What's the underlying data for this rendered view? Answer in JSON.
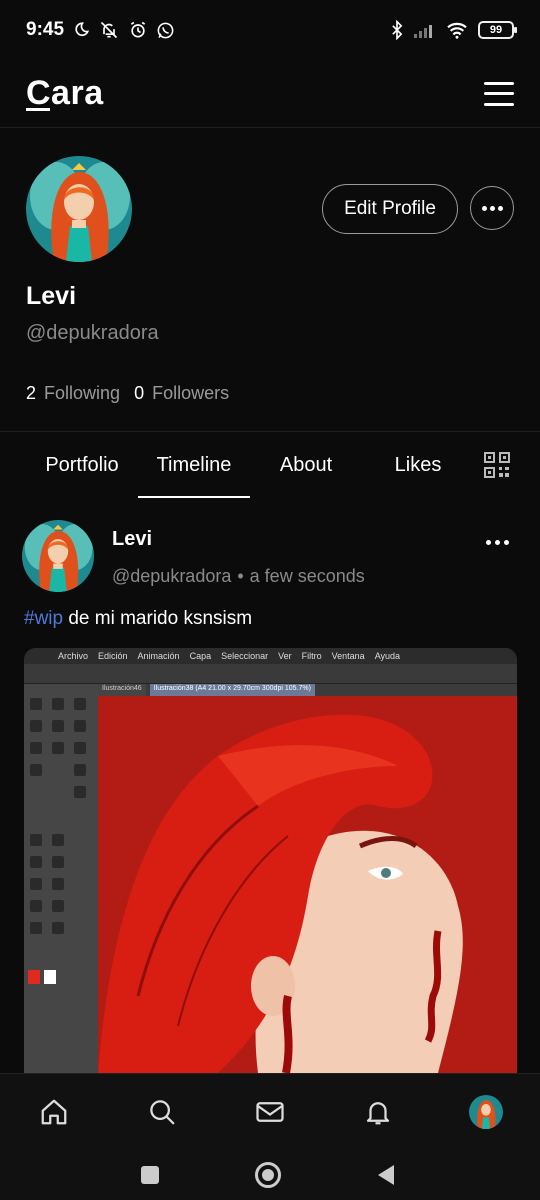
{
  "status_bar": {
    "time": "9:45",
    "battery": "99",
    "left_icons": [
      "moon-icon",
      "muted-bell-icon",
      "alarm-icon",
      "whatsapp-icon"
    ],
    "right_icons": [
      "bluetooth-icon",
      "signal-icon",
      "wifi-icon",
      "battery-icon"
    ]
  },
  "header": {
    "brand": "Cara",
    "menu_icon": "hamburger-menu-icon"
  },
  "profile": {
    "name": "Levi",
    "handle": "@depukradora",
    "following_count": "2",
    "following_label": "Following",
    "followers_count": "0",
    "followers_label": "Followers",
    "edit_button": "Edit Profile",
    "more_icon": "more-horizontal-icon"
  },
  "tabs": [
    {
      "label": "Portfolio",
      "active": false
    },
    {
      "label": "Timeline",
      "active": true
    },
    {
      "label": "About",
      "active": false
    },
    {
      "label": "Likes",
      "active": false
    }
  ],
  "qr_icon": "qr-code-icon",
  "post": {
    "author": "Levi",
    "handle": "@depukradora",
    "separator": "•",
    "time": "a few seconds",
    "hashtag": "#wip",
    "text": " de mi marido ksnsism",
    "image": {
      "menu": [
        "Archivo",
        "Edición",
        "Animación",
        "Capa",
        "Seleccionar",
        "Ver",
        "Filtro",
        "Ventana",
        "Ayuda"
      ],
      "tab1": "Ilustración46",
      "tab2": "Ilustración38 (A4 21.00 x 29.70cm 300dpi 105.7%)"
    }
  },
  "bottom_nav": [
    "home-icon",
    "search-icon",
    "mail-icon",
    "bell-icon",
    "avatar"
  ],
  "system_nav": [
    "recents-square-icon",
    "home-circle-icon",
    "back-triangle-icon"
  ],
  "colors": {
    "background": "#0b0b0b",
    "hashtag": "#4b7bd6",
    "canvas_red": "#b31c14",
    "text_muted": "#8a8a8a"
  }
}
